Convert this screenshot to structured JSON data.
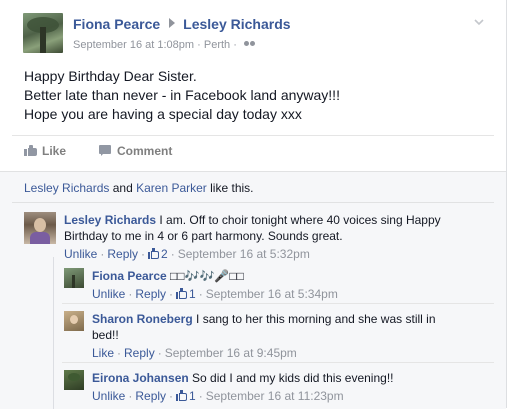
{
  "post": {
    "author": "Fiona Pearce",
    "target": "Lesley Richards",
    "timestamp": "September 16 at 1:08pm",
    "location": "Perth",
    "text_lines": [
      "Happy Birthday Dear Sister.",
      "Better late than never - in Facebook land anyway!!!",
      "Hope you are having a special day today xxx"
    ],
    "actions": {
      "like": "Like",
      "comment": "Comment"
    },
    "likes_line": {
      "name1": "Lesley Richards",
      "and": "and",
      "name2": "Karen Parker",
      "suffix": "like this."
    }
  },
  "comments": [
    {
      "author": "Lesley Richards",
      "text": "I am. Off to choir tonight where 40 voices sing Happy Birthday to me in 4 or 6 part harmony. Sounds great.",
      "unlike": "Unlike",
      "reply": "Reply",
      "likes": "2",
      "time": "September 16 at 5:32pm"
    }
  ],
  "replies": [
    {
      "author": "Fiona Pearce",
      "text": "□□🎶🎶🎤□□",
      "unlike": "Unlike",
      "reply": "Reply",
      "likes": "1",
      "time": "September 16 at 5:34pm"
    },
    {
      "author": "Sharon Roneberg",
      "text": "I sang to her this morning and she was still in bed!!",
      "like": "Like",
      "reply": "Reply",
      "time": "September 16 at 9:45pm"
    },
    {
      "author": "Eirona Johansen",
      "text": "So did I and my kids did this evening!!",
      "unlike": "Unlike",
      "reply": "Reply",
      "likes": "1",
      "time": "September 16 at 11:23pm"
    }
  ],
  "colors": {
    "link": "#3b5998",
    "meta": "#90949c",
    "footer_bg": "#f6f7f9"
  },
  "icons": {
    "arrow": "arrow-right-icon",
    "audience": "friends-icon",
    "chevron": "chevron-down-icon"
  }
}
